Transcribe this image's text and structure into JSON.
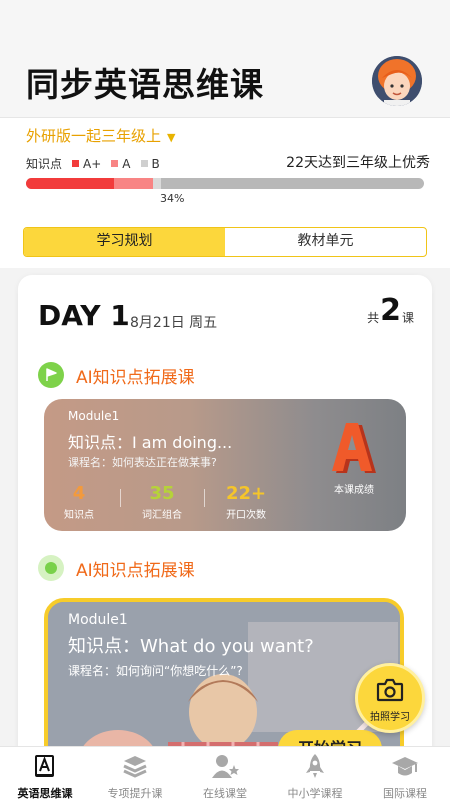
{
  "header": {
    "title": "同步英语思维课"
  },
  "grade": {
    "selector_label": "外研版一起三年级上",
    "caret": "▼"
  },
  "mastery": {
    "legend_title": "知识点",
    "legend": [
      {
        "label": "A+",
        "color": "#f23b3b"
      },
      {
        "label": "A",
        "color": "#f88484"
      },
      {
        "label": "B",
        "color": "#cfcfcf"
      }
    ],
    "goal_text": "22天达到三年级上优秀",
    "progress_percent_label": "34%",
    "progress_fractions": {
      "a_plus": 0.22,
      "a": 0.1,
      "b": 0.02
    }
  },
  "tabs": [
    {
      "label": "学习规划",
      "active": true
    },
    {
      "label": "教材单元",
      "active": false
    }
  ],
  "day": {
    "title": "DAY 1",
    "date": "8月21日 周五",
    "count_prefix": "共",
    "count": "2",
    "count_suffix": "课"
  },
  "lessons": [
    {
      "section_title": "AI知识点拓展课",
      "module": "Module1",
      "knowledge": "知识点：I am doing...",
      "course_name": "课程名：如何表达正在做某事?",
      "stats": [
        {
          "value": "4",
          "label": "知识点",
          "color": "#f39a3c"
        },
        {
          "value": "35",
          "label": "词汇组合",
          "color": "#b6d23a"
        },
        {
          "value": "22+",
          "label": "开口次数",
          "color": "#f5c52a"
        }
      ],
      "grade_badge": "A",
      "grade_caption": "本课成绩"
    },
    {
      "section_title": "AI知识点拓展课",
      "module": "Module1",
      "knowledge": "知识点：What do you want?",
      "course_name": "课程名：如何询问“你想吃什么”?",
      "start_label": "开始学习"
    }
  ],
  "fab": {
    "label": "拍照学习"
  },
  "nav": [
    {
      "label": "英语思维课",
      "icon": "book-a-icon",
      "active": true
    },
    {
      "label": "专项提升课",
      "icon": "stack-icon",
      "active": false
    },
    {
      "label": "在线课堂",
      "icon": "teacher-icon",
      "active": false
    },
    {
      "label": "中小学课程",
      "icon": "rocket-icon",
      "active": false
    },
    {
      "label": "国际课程",
      "icon": "graduation-cap-icon",
      "active": false
    }
  ],
  "colors": {
    "accent": "#fcd73c",
    "orange": "#f06a1a",
    "green": "#7ed24a"
  }
}
